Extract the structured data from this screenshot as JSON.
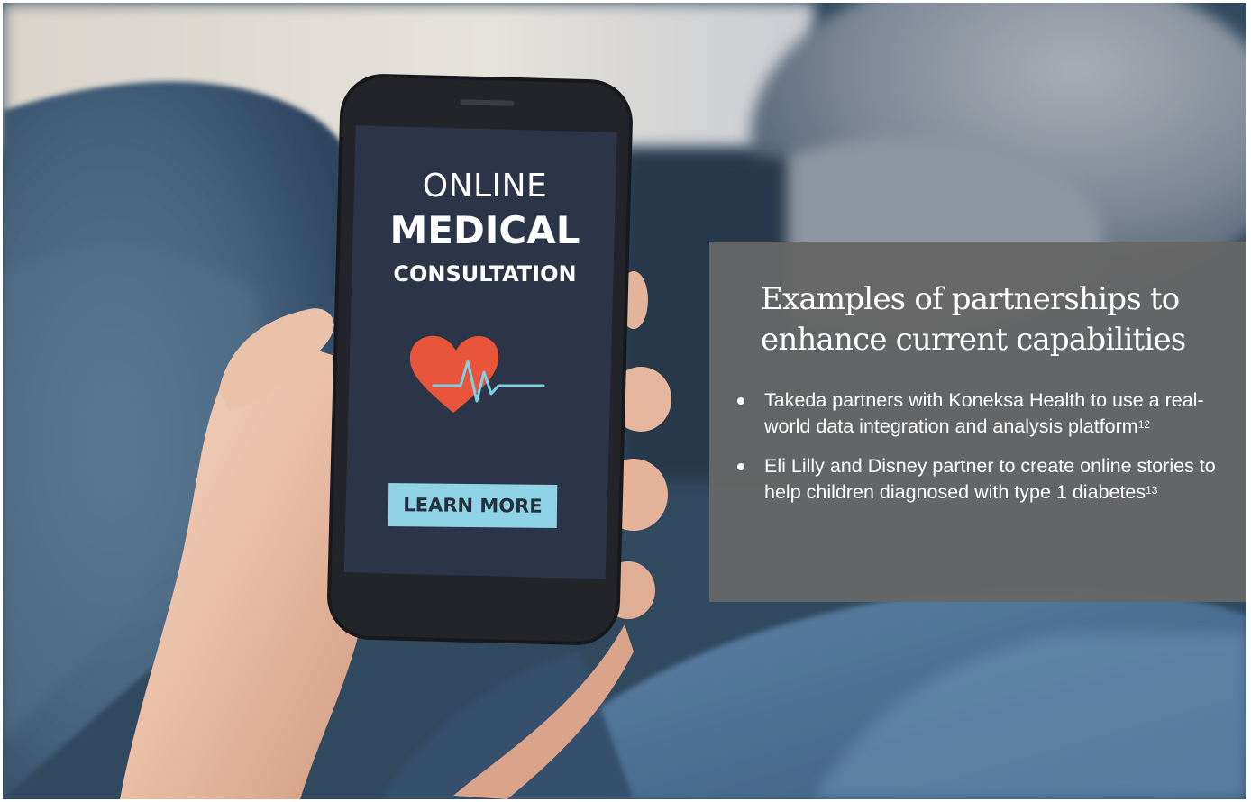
{
  "photo": {
    "alt_subject": "hand-holding-smartphone-icon",
    "phone_screen": {
      "line1": "ONLINE",
      "line2": "MEDICAL",
      "line3": "CONSULTATION",
      "button_label": "LEARN MORE",
      "icon": "heart-heartbeat-icon",
      "colors": {
        "screen": "#2c3447",
        "heart": "#e8553a",
        "pulse": "#7fd0e4",
        "button": "#8fd3e6"
      }
    }
  },
  "panel": {
    "title": "Examples of partnerships to enhance current capabilities",
    "bullets": [
      {
        "text": "Takeda partners with Koneksa Health to use a real-world data integration and analysis platform",
        "ref": "12"
      },
      {
        "text": "Eli Lilly and Disney partner to create online stories to help children diagnosed with type 1 diabetes",
        "ref": "13"
      }
    ],
    "background": "#666666"
  }
}
